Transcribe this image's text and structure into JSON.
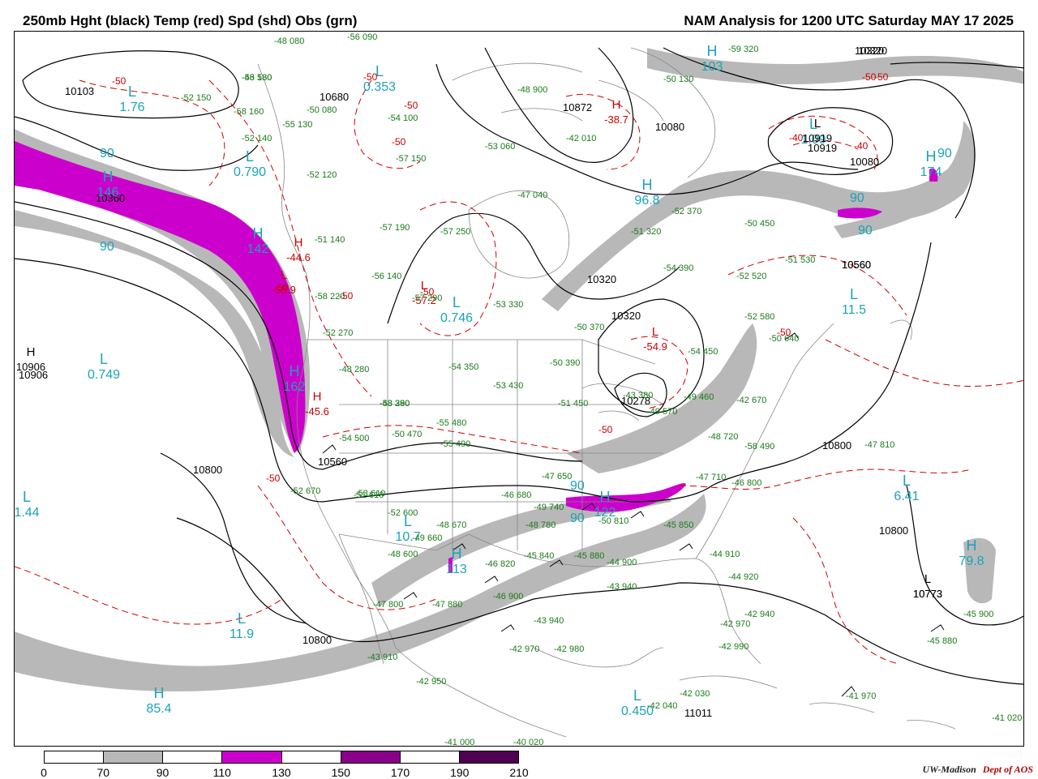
{
  "header": {
    "left_title": "250mb Hght (black) Temp (red) Spd (shd) Obs (grn)",
    "right_title": "NAM Analysis for 1200 UTC Saturday  MAY 17 2025"
  },
  "colors": {
    "height": "#000000",
    "temperature": "#cc0000",
    "obs": "#1a7a1a",
    "speed_label": "#1aa3b8",
    "shade_70": "#b8b8b8",
    "shade_110": "#cc00cc",
    "shade_150": "#8a008a",
    "shade_190": "#500050",
    "geography": "#888888"
  },
  "legend": {
    "ticks": [
      "0",
      "70",
      "90",
      "110",
      "130",
      "150",
      "170",
      "190",
      "210"
    ],
    "fills": [
      "#ffffff",
      "#b8b8b8",
      "#ffffff",
      "#cc00cc",
      "#ffffff",
      "#8a008a",
      "#ffffff",
      "#500050"
    ]
  },
  "credit": {
    "org": "UW-Madison",
    "dept": "Dept of AOS"
  },
  "labels": {
    "height_labels": [
      "10103",
      "10320",
      "10360",
      "10680",
      "10872",
      "10080",
      "10919",
      "10080",
      "10320",
      "10560",
      "10320",
      "10320",
      "10560",
      "10906",
      "10800",
      "10560",
      "10800",
      "10800",
      "10800",
      "10773",
      "11011",
      "10278"
    ],
    "extrema": [
      {
        "kind": "speed",
        "letter": "L",
        "value": "1.76"
      },
      {
        "kind": "speed",
        "letter": "L",
        "value": "0.353"
      },
      {
        "kind": "speed",
        "letter": "L",
        "value": "0.790"
      },
      {
        "kind": "speed",
        "letter": "H",
        "value": "103"
      },
      {
        "kind": "speed",
        "letter": "L",
        "value": "1.09"
      },
      {
        "kind": "speed",
        "letter": "H",
        "value": "96.8"
      },
      {
        "kind": "speed",
        "letter": "H",
        "value": "146"
      },
      {
        "kind": "speed",
        "letter": "H",
        "value": "142"
      },
      {
        "kind": "speed",
        "letter": "L",
        "value": "0.746"
      },
      {
        "kind": "speed",
        "letter": "L",
        "value": "0.749"
      },
      {
        "kind": "speed",
        "letter": "H",
        "value": "162"
      },
      {
        "kind": "speed",
        "letter": "L",
        "value": "1.44"
      },
      {
        "kind": "speed",
        "letter": "L",
        "value": "10.7"
      },
      {
        "kind": "speed",
        "letter": "H",
        "value": "113"
      },
      {
        "kind": "speed",
        "letter": "H",
        "value": "122"
      },
      {
        "kind": "speed",
        "letter": "L",
        "value": "6.41"
      },
      {
        "kind": "speed",
        "letter": "H",
        "value": "79.8"
      },
      {
        "kind": "speed",
        "letter": "L",
        "value": "11.5"
      },
      {
        "kind": "speed",
        "letter": "L",
        "value": "11.9"
      },
      {
        "kind": "speed",
        "letter": "H",
        "value": "85.4"
      },
      {
        "kind": "speed",
        "letter": "L",
        "value": "0.450"
      },
      {
        "kind": "speed",
        "letter": "H",
        "value": "174"
      },
      {
        "kind": "temp",
        "letter": "H",
        "value": "-38.7"
      },
      {
        "kind": "temp",
        "letter": "H",
        "value": "-44.6"
      },
      {
        "kind": "temp",
        "letter": "L",
        "value": "-57.2"
      },
      {
        "kind": "temp",
        "letter": "L",
        "value": "-54.9"
      },
      {
        "kind": "temp",
        "letter": "H",
        "value": "-45.6"
      },
      {
        "kind": "temp",
        "letter": "L",
        "value": "-55.9"
      },
      {
        "kind": "height",
        "letter": "H",
        "value": "10906"
      },
      {
        "kind": "height",
        "letter": "L",
        "value": "10773"
      },
      {
        "kind": "height",
        "letter": "L",
        "value": "10919"
      }
    ],
    "speed_contour_values": [
      "90",
      "90",
      "90",
      "90",
      "90",
      "90",
      "90"
    ],
    "temp_contour_values": [
      "-50",
      "-50",
      "-50",
      "-50",
      "-40",
      "-40",
      "-50",
      "-50",
      "-50",
      "-50",
      "-50",
      "-50",
      "-50",
      "-50"
    ],
    "obs": [
      "-56 180",
      "-52 150",
      "-58 160",
      "-55 130",
      "-52 140",
      "-52 120",
      "-48 080",
      "-56 090",
      "-50 080",
      "-54 100",
      "-57 150",
      "-53 060",
      "-47 040",
      "-42 010",
      "-48 900",
      "-50 130",
      "-59 320",
      "-52 370",
      "-51 320",
      "-50 450",
      "-51 530",
      "-52 520",
      "-54 390",
      "-52 580",
      "-50 640",
      "-57 190",
      "-57 250",
      "-53 330",
      "-56 140",
      "-51 140",
      "-58 220",
      "-52 270",
      "-48 280",
      "-57 290",
      "-50 370",
      "-50 390",
      "-54 350",
      "-53 430",
      "-51 450",
      "-58 390",
      "-54 450",
      "-49 460",
      "-42 670",
      "-55 480",
      "-55 490",
      "-50 470",
      "-54 500",
      "-51 610",
      "-52 670",
      "-53 610",
      "-52 600",
      "-48 670",
      "-49 660",
      "-48 600",
      "-47 650",
      "-46 680",
      "-49 740",
      "-48 780",
      "-50 810",
      "-46 820",
      "-45 840",
      "-45 880",
      "-44 900",
      "-43 940",
      "-45 850",
      "-44 910",
      "-47 710",
      "-48 720",
      "-46 800",
      "-44 920",
      "-42 940",
      "-42 970",
      "-42 990",
      "-47 800",
      "-47 880",
      "-46 900",
      "-43 940",
      "-42 970",
      "-42 980",
      "-43 910",
      "-42 950",
      "-41 000",
      "-40 020",
      "-42 040",
      "-42 030",
      "-41 970",
      "-41 020",
      "-45 900",
      "-45 880",
      "-47 810",
      "-49 570",
      "-43 380",
      "-43 280",
      "-58 490",
      "-43 530"
    ]
  }
}
